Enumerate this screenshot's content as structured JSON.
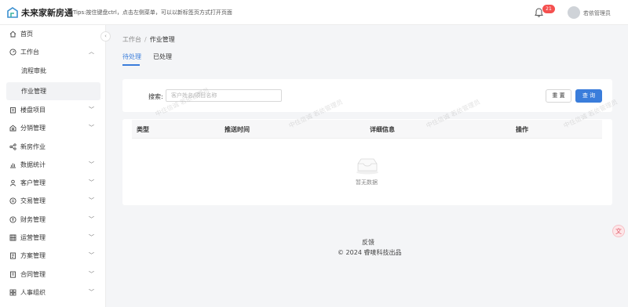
{
  "header": {
    "app_title": "未来家新房通",
    "tips": "Tips:按住键盘ctrl，点击左侧菜单，可以以新标签页方式打开页面",
    "notification_count": "21",
    "user_name": "若依管理员"
  },
  "sidebar": {
    "collapse_icon": "‹",
    "items": [
      {
        "label": "首页",
        "icon": "home-icon"
      },
      {
        "label": "工作台",
        "icon": "dashboard-icon",
        "expanded": true
      },
      {
        "label": "流程审批",
        "sub": true
      },
      {
        "label": "作业管理",
        "sub": true,
        "active": true
      },
      {
        "label": "楼盘项目",
        "icon": "building-icon"
      },
      {
        "label": "分销管理",
        "icon": "distribution-icon"
      },
      {
        "label": "新房作业",
        "icon": "share-icon"
      },
      {
        "label": "数据统计",
        "icon": "chart-icon"
      },
      {
        "label": "客户管理",
        "icon": "user-icon"
      },
      {
        "label": "交易管理",
        "icon": "transaction-icon"
      },
      {
        "label": "财务管理",
        "icon": "finance-icon"
      },
      {
        "label": "运营管理",
        "icon": "grid-icon"
      },
      {
        "label": "方案管理",
        "icon": "document-icon"
      },
      {
        "label": "合同管理",
        "icon": "contract-icon"
      },
      {
        "label": "人事组织",
        "icon": "organization-icon"
      }
    ]
  },
  "breadcrumb": {
    "root": "工作台",
    "separator": "/",
    "current": "作业管理"
  },
  "tabs": [
    {
      "label": "待处理",
      "active": true
    },
    {
      "label": "已处理",
      "active": false
    }
  ],
  "search": {
    "label": "搜索:",
    "placeholder": "客户姓名/项目名称",
    "value": "",
    "reset_label": "重 置",
    "query_label": "查 询"
  },
  "table": {
    "columns": [
      "类型",
      "推送时间",
      "详细信息",
      "操作"
    ],
    "rows": [],
    "empty_text": "暂无数据"
  },
  "watermark": "中住信诚 若依管理员",
  "footer": {
    "feedback": "反馈",
    "copyright": "© 2024 睿唛科技出品"
  },
  "colors": {
    "accent": "#3a7ddb",
    "badge": "#f5504f"
  }
}
